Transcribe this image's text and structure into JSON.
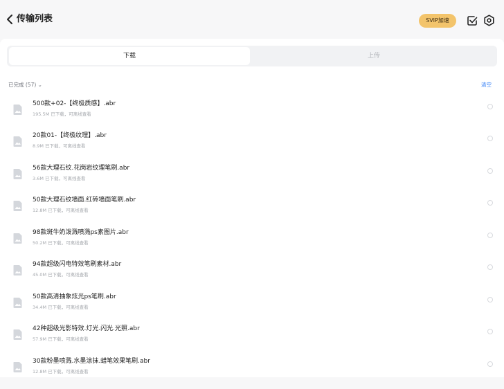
{
  "header": {
    "title": "传输列表",
    "svip_label": "SVIP加速"
  },
  "tabs": [
    {
      "label": "下载"
    },
    {
      "label": "上传"
    }
  ],
  "section": {
    "label": "已完成 (57) ⌄",
    "clear_label": "清空"
  },
  "files": [
    {
      "name": "500款+02-【终极质感】.abr",
      "meta": "195.5M  已下载，可离线查看"
    },
    {
      "name": "20款01-【终极纹理】.abr",
      "meta": "8.9M  已下载，可离线查看"
    },
    {
      "name": "56款大理石纹.花岗岩纹理笔刷.abr",
      "meta": "3.6M  已下载，可离线查看"
    },
    {
      "name": "50款大理石纹墙面.红砖墙面笔刷.abr",
      "meta": "12.8M  已下载，可离线查看"
    },
    {
      "name": "98款斑牛奶泼溅喷溅ps素图片.abr",
      "meta": "50.2M  已下载，可离线查看"
    },
    {
      "name": "94款超级闪电特效笔刷素材.abr",
      "meta": "45.0M  已下载，可离线查看"
    },
    {
      "name": "50款高清抽象炫光ps笔刷.abr",
      "meta": "34.4M  已下载，可离线查看"
    },
    {
      "name": "42种超级光影特效.灯光.闪光.光照.abr",
      "meta": "57.9M  已下载，可离线查看"
    },
    {
      "name": "30款粉墨喷溅.水墨涂抹.蜡笔效果笔刷.abr",
      "meta": "12.8M  已下载，可离线查看"
    }
  ],
  "colors": {
    "accent": "#2f7cf6",
    "svip": "#f3c46b"
  },
  "icons": {
    "back": "chevron-left-icon",
    "select": "checkbox-icon",
    "settings": "settings-icon",
    "file": "file-icon"
  }
}
